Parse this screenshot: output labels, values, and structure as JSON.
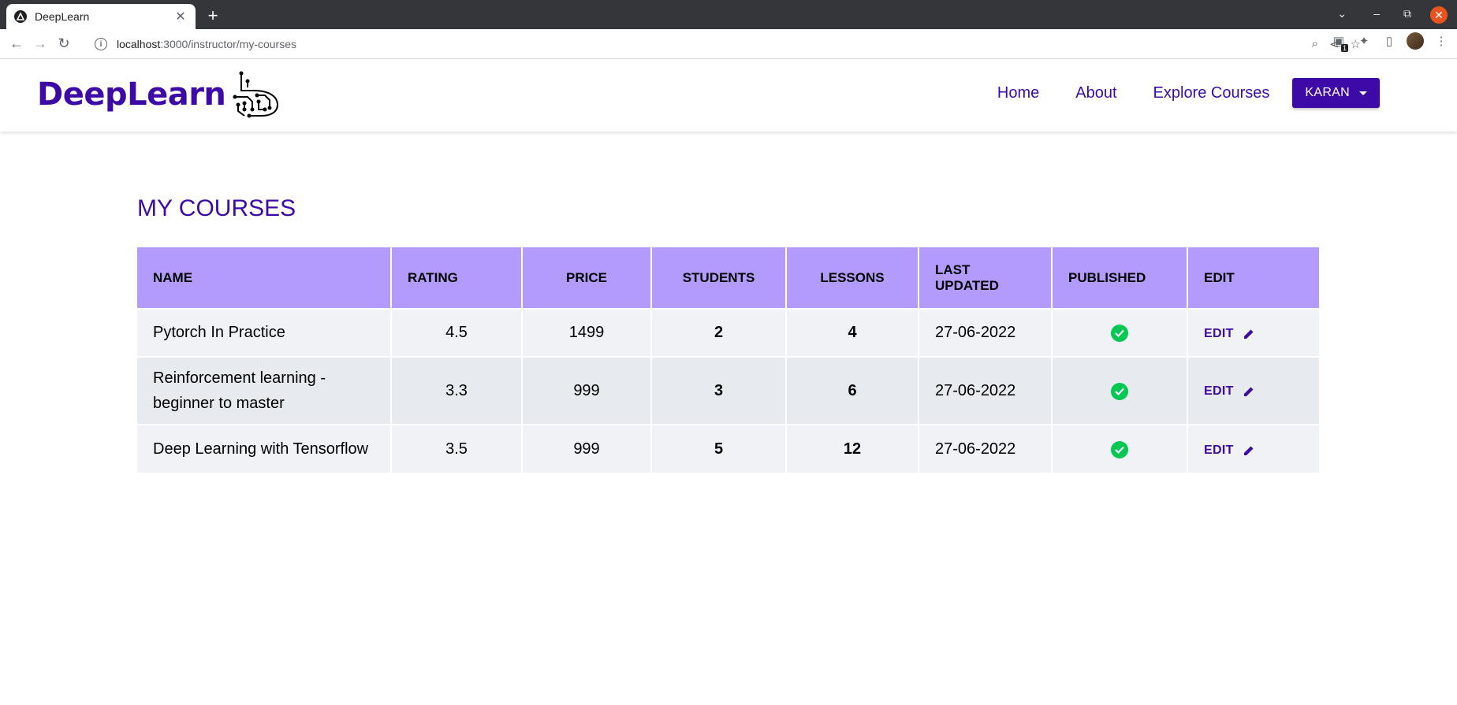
{
  "browser": {
    "tab_title": "DeepLearn",
    "tab_close": "✕",
    "new_tab": "+",
    "url_host": "localhost",
    "url_path": ":3000/instructor/my-courses",
    "ext_badge": "1"
  },
  "header": {
    "brand": "DeepLearn",
    "nav": [
      {
        "label": "Home"
      },
      {
        "label": "About"
      },
      {
        "label": "Explore Courses"
      }
    ],
    "user_button": "KARAN"
  },
  "page": {
    "title": "MY COURSES"
  },
  "table": {
    "columns": [
      "NAME",
      "RATING",
      "PRICE",
      "STUDENTS",
      "LESSONS",
      "LAST UPDATED",
      "PUBLISHED",
      "EDIT"
    ],
    "rows": [
      {
        "name": "Pytorch In Practice",
        "rating": "4.5",
        "price": "1499",
        "students": "2",
        "lessons": "4",
        "last_updated": "27-06-2022",
        "published": true,
        "edit": "EDIT"
      },
      {
        "name": "Reinforcement learning - beginner to master",
        "rating": "3.3",
        "price": "999",
        "students": "3",
        "lessons": "6",
        "last_updated": "27-06-2022",
        "published": true,
        "edit": "EDIT"
      },
      {
        "name": "Deep Learning with Tensorflow",
        "rating": "3.5",
        "price": "999",
        "students": "5",
        "lessons": "12",
        "last_updated": "27-06-2022",
        "published": true,
        "edit": "EDIT"
      }
    ]
  },
  "colors": {
    "brand": "#3d0aa8",
    "table_header": "#b39afd",
    "published": "#00c853"
  }
}
